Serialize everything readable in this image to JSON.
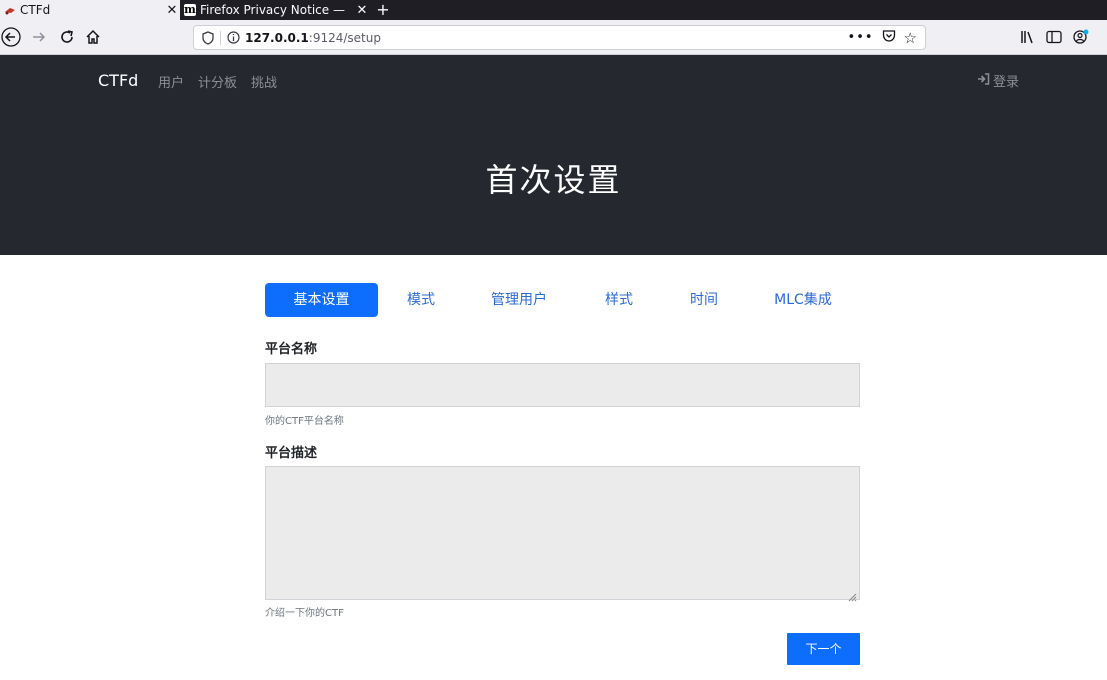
{
  "browser": {
    "tabs": [
      {
        "title": "CTFd",
        "active": true
      },
      {
        "title": "Firefox Privacy Notice —",
        "favicon": "m",
        "active": false
      }
    ],
    "url_host": "127.0.0.1",
    "url_rest": ":9124/setup",
    "icons": [
      "back-icon",
      "forward-icon",
      "reload-icon",
      "home-icon",
      "shield-icon",
      "info-icon",
      "more-icon",
      "pocket-icon",
      "star-icon",
      "library-icon",
      "sidebar-icon",
      "account-icon"
    ]
  },
  "nav": {
    "brand": "CTFd",
    "links": [
      "用户",
      "计分板",
      "挑战"
    ],
    "login": "登录"
  },
  "hero": {
    "title": "首次设置"
  },
  "setup_tabs": [
    "基本设置",
    "模式",
    "管理用户",
    "样式",
    "时间",
    "MLC集成"
  ],
  "form": {
    "name_label": "平台名称",
    "name_value": "",
    "name_hint": "你的CTF平台名称",
    "desc_label": "平台描述",
    "desc_value": "",
    "desc_hint": "介绍一下你的CTF"
  },
  "next_button": "下一个",
  "colors": {
    "hero_bg": "#25282e",
    "primary": "#0d6efd",
    "field_bg": "#ebebeb"
  }
}
